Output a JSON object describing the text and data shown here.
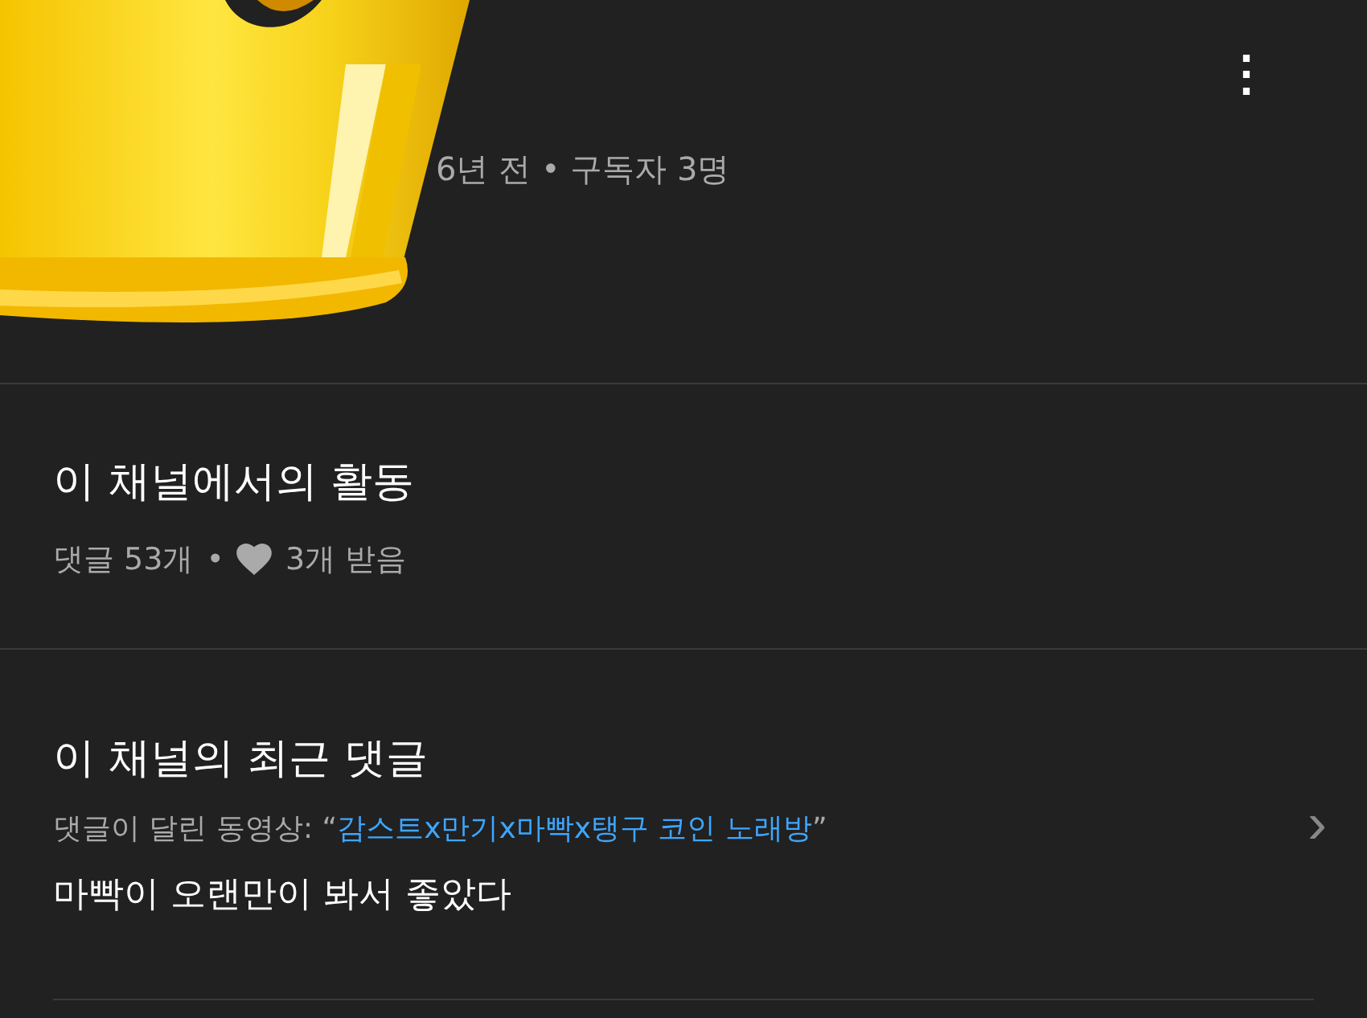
{
  "header": {
    "meta": "6년 전 • 구독자 3명",
    "menu_icon": "⋮"
  },
  "activity": {
    "title": "이 채널에서의 활동",
    "comments": "댓글 53개",
    "separator": "•",
    "likes": "3개 받음"
  },
  "recent": {
    "title": "이 채널의 최근 댓글",
    "video_label": "댓글이 달린 동영상: “",
    "video_title": "감스트x만기x마빡x탱구 코인 노래방",
    "quote_close": "”",
    "comment": "마빡이 오랜만이 봐서 좋았다",
    "chevron": "›"
  }
}
